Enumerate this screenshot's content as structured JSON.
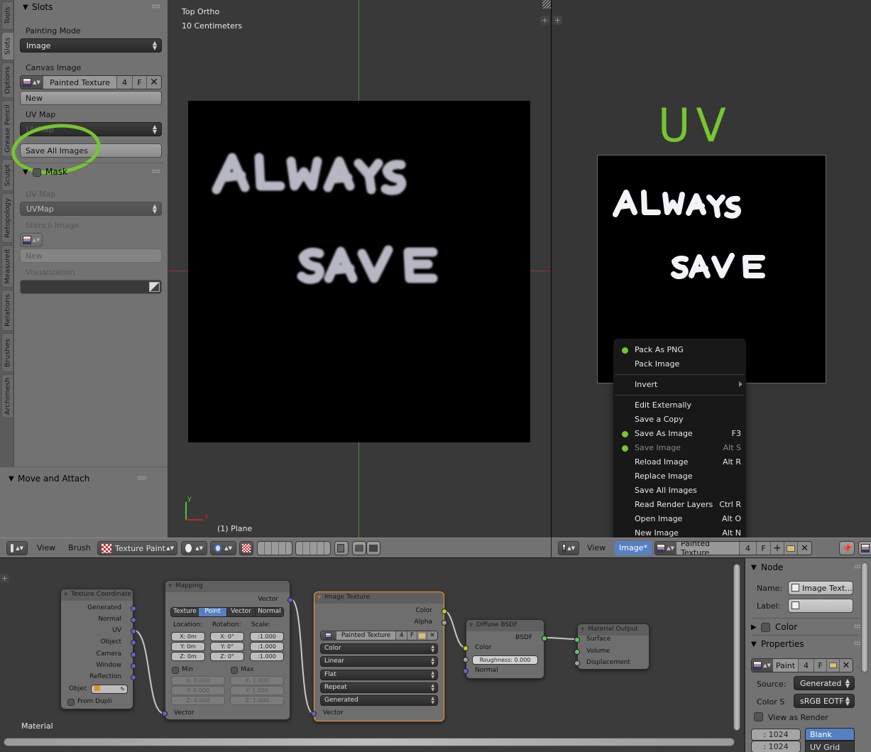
{
  "toolshelf": {
    "tabs": [
      "Tools",
      "Slots",
      "Options",
      "Grease Pencil",
      "Sculpt",
      "Retopology",
      "Measureit",
      "Relations",
      "Brushes",
      "Archimesh"
    ],
    "active_tab": "Slots",
    "slots_panel": {
      "title": "Slots",
      "painting_mode_label": "Painting Mode",
      "painting_mode_value": "Image",
      "canvas_image_label": "Canvas Image",
      "canvas_image_name": "Painted Texture",
      "canvas_image_users": "4",
      "canvas_image_fake": "F",
      "new_label": "New",
      "uv_map_label": "UV Map",
      "uv_map_value": "UVMap",
      "save_all_label": "Save All Images"
    },
    "mask_panel": {
      "title": "Mask",
      "uv_map_label": "UV Map",
      "uv_map_value": "UVMap",
      "stencil_label": "Stencil Image",
      "new_label": "New",
      "visualization_label": "Visualization"
    },
    "move_attach_panel": {
      "title": "Move and Attach"
    }
  },
  "view3d": {
    "view_name": "Top Ortho",
    "scale": "10 Centimeters",
    "object_label": "(1) Plane",
    "axis_x": "x",
    "axis_y": "y",
    "painted_text_line1": "ALWAYS",
    "painted_text_line2": "SAVE",
    "header": {
      "view_menu": "View",
      "brush_menu": "Brush",
      "mode": "Texture Paint"
    }
  },
  "image_editor": {
    "annotation": "UV",
    "painted_text_line1": "ALWAYS",
    "painted_text_line2": "SAVE",
    "header": {
      "view_menu": "View",
      "image_menu": "Image*",
      "image_name": "Painted Texture",
      "users": "4",
      "fake": "F"
    },
    "menu": {
      "items": [
        {
          "label": "Pack As PNG",
          "shortcut": "",
          "highlight": true,
          "disabled": false
        },
        {
          "label": "Pack Image",
          "shortcut": "",
          "highlight": false,
          "disabled": false
        },
        {
          "label": "Invert",
          "shortcut": "",
          "highlight": false,
          "disabled": false,
          "submenu": true
        },
        {
          "label": "Edit Externally",
          "shortcut": "",
          "highlight": false,
          "disabled": false
        },
        {
          "label": "Save a Copy",
          "shortcut": "",
          "highlight": false,
          "disabled": false
        },
        {
          "label": "Save As Image",
          "shortcut": "F3",
          "highlight": true,
          "disabled": false
        },
        {
          "label": "Save Image",
          "shortcut": "Alt S",
          "highlight": true,
          "disabled": true
        },
        {
          "label": "Reload Image",
          "shortcut": "Alt R",
          "highlight": false,
          "disabled": false
        },
        {
          "label": "Replace Image",
          "shortcut": "",
          "highlight": false,
          "disabled": false
        },
        {
          "label": "Save All Images",
          "shortcut": "",
          "highlight": false,
          "disabled": false
        },
        {
          "label": "Read Render Layers",
          "shortcut": "Ctrl R",
          "highlight": false,
          "disabled": false
        },
        {
          "label": "Open Image",
          "shortcut": "Alt O",
          "highlight": false,
          "disabled": false
        },
        {
          "label": "New Image",
          "shortcut": "Alt N",
          "highlight": false,
          "disabled": false
        }
      ]
    }
  },
  "node_editor": {
    "context_label": "Material",
    "nodes": {
      "texcoord": {
        "title": "Texture Coordinate",
        "outputs": [
          "Generated",
          "Normal",
          "UV",
          "Object",
          "Camera",
          "Window",
          "Reflection"
        ],
        "object_label": "Objec",
        "from_dupli_label": "From Dupli"
      },
      "mapping": {
        "title": "Mapping",
        "output": "Vector",
        "input": "Vector",
        "types": [
          "Texture",
          "Point",
          "Vector",
          "Normal"
        ],
        "active_type": "Point",
        "location_label": "Location:",
        "rotation_label": "Rotation:",
        "scale_label": "Scale:",
        "location": [
          "X: 0m",
          "Y: 0m",
          "Z: 0m"
        ],
        "rotation": [
          "X:  0°",
          "Y:  0°",
          "Z:  0°"
        ],
        "scale": [
          ":1.000",
          ":1.000",
          ":1.000"
        ],
        "min_label": "Min",
        "max_label": "Max",
        "min": [
          "X:  0.000",
          "Y:  0.000",
          "Z:  0.000"
        ],
        "max": [
          "X:  1.000",
          "Y:  1.000",
          "Z:  1.000"
        ]
      },
      "imagetex": {
        "title": "Image Texture",
        "outputs": [
          "Color",
          "Alpha"
        ],
        "image_name": "Painted Texture",
        "users": "4",
        "fake": "F",
        "color_space": "Color",
        "interpolation": "Linear",
        "projection": "Flat",
        "extension": "Repeat",
        "source": "Generated",
        "input": "Vector"
      },
      "diffuse": {
        "title": "Diffuse BSDF",
        "output": "BSDF",
        "inputs": [
          "Color",
          "Normal"
        ],
        "roughness": "Roughness:  0.000"
      },
      "output": {
        "title": "Material Output",
        "inputs": [
          "Surface",
          "Volume",
          "Displacement"
        ]
      }
    }
  },
  "node_panel": {
    "node_section": "Node",
    "name_label": "Name:",
    "name_value": "Image Text...",
    "label_label": "Label:",
    "label_value": "",
    "color_section": "Color",
    "properties_section": "Properties",
    "image_name": "Paint",
    "users": "4",
    "fake": "F",
    "source_label": "Source:",
    "source_value": "Generated",
    "colorspace_label": "Color S",
    "colorspace_value": "sRGB EOTF",
    "view_as_render": "View as Render",
    "width": ": 1024",
    "height": ": 1024",
    "gen_types": [
      "Blank",
      "UV Grid"
    ],
    "active_gen_type": "Blank"
  }
}
